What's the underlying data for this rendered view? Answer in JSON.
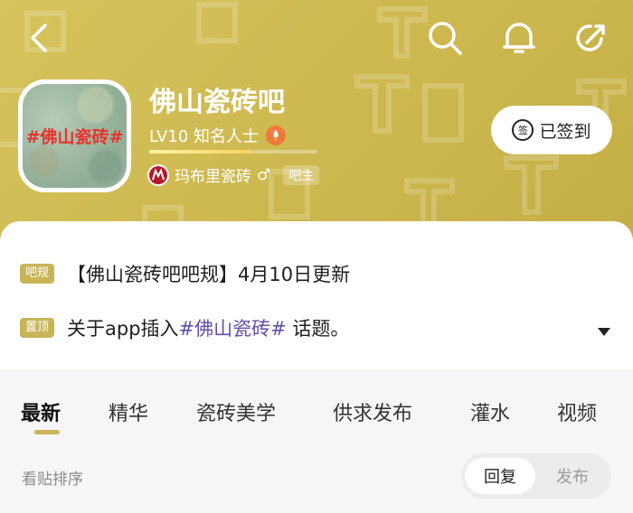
{
  "header": {
    "forum_name": "佛山瓷砖吧",
    "avatar_text": "#佛山瓷砖#",
    "level": "LV10 知名人士",
    "level_progress": 0.6,
    "owner_name": "玛布里瓷砖",
    "owner_gender": "♂",
    "owner_role": "吧主",
    "signin_label": "已签到",
    "signin_icon_text": "签",
    "accent_color": "#cdb84f"
  },
  "notices": {
    "rule_tag": "吧规",
    "rule_text": "【佛山瓷砖吧吧规】4月10日更新",
    "pinned_tag": "置顶",
    "pinned_prefix": "关于app插入",
    "pinned_topic": "#佛山瓷砖#",
    "pinned_suffix": " 话题。"
  },
  "tabs": [
    {
      "label": "最新"
    },
    {
      "label": "精华"
    },
    {
      "label": "瓷砖美学"
    },
    {
      "label": "供求发布"
    },
    {
      "label": "灌水"
    },
    {
      "label": "视频"
    }
  ],
  "sort": {
    "label": "看贴排序",
    "options": [
      "回复",
      "发布"
    ],
    "selected": "回复"
  },
  "icons": {
    "back": "chevron-left-icon",
    "search": "search-icon",
    "bell": "bell-icon",
    "share": "share-icon",
    "expand": "caret-down-icon"
  }
}
